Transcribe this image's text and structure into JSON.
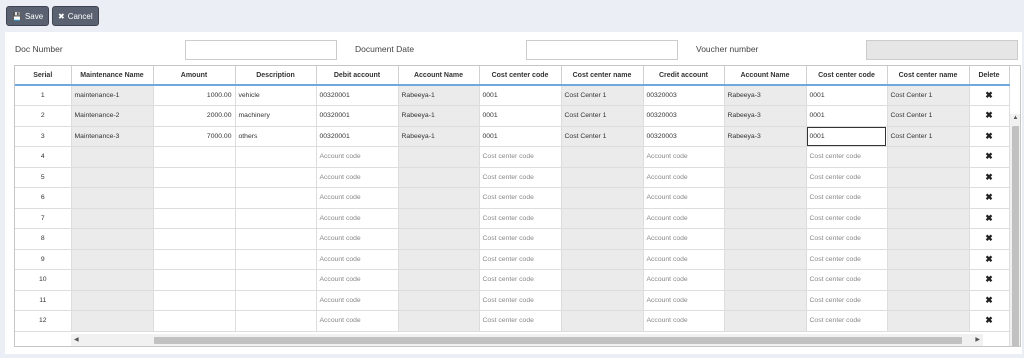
{
  "toolbar": {
    "save_label": "Save",
    "cancel_label": "Cancel",
    "save_icon": "floppy-icon",
    "cancel_icon": "close-icon"
  },
  "form": {
    "doc_number_label": "Doc Number",
    "doc_number_value": "",
    "document_date_label": "Document Date",
    "document_date_value": "",
    "voucher_number_label": "Voucher number",
    "voucher_number_value": ""
  },
  "table": {
    "columns": [
      "Serial",
      "Maintenance Name",
      "Amount",
      "Description",
      "Debit account",
      "Account Name",
      "Cost center code",
      "Cost center name",
      "Credit account",
      "Account Name",
      "Cost center code",
      "Cost center name",
      "Delete"
    ],
    "rows": [
      [
        "1",
        "maintenance-1",
        "1000.00",
        "vehicle",
        "00320001",
        "Rabeeya-1",
        "0001",
        "Cost Center 1",
        "00320003",
        "Rabeeya-3",
        "0001",
        "Cost Center 1"
      ],
      [
        "2",
        "Maintenance-2",
        "2000.00",
        "machinery",
        "00320001",
        "Rabeeya-1",
        "0001",
        "Cost Center 1",
        "00320003",
        "Rabeeya-3",
        "0001",
        "Cost Center 1"
      ],
      [
        "3",
        "Maintenance-3",
        "7000.00",
        "others",
        "00320001",
        "Rabeeya-1",
        "0001",
        "Cost Center 1",
        "00320003",
        "Rabeeya-3",
        "0001",
        "Cost Center 1"
      ],
      [
        "4",
        "",
        "",
        "",
        "",
        "",
        "",
        "",
        "",
        "",
        "",
        ""
      ],
      [
        "5",
        "",
        "",
        "",
        "",
        "",
        "",
        "",
        "",
        "",
        "",
        ""
      ],
      [
        "6",
        "",
        "",
        "",
        "",
        "",
        "",
        "",
        "",
        "",
        "",
        ""
      ],
      [
        "7",
        "",
        "",
        "",
        "",
        "",
        "",
        "",
        "",
        "",
        "",
        ""
      ],
      [
        "8",
        "",
        "",
        "",
        "",
        "",
        "",
        "",
        "",
        "",
        "",
        ""
      ],
      [
        "9",
        "",
        "",
        "",
        "",
        "",
        "",
        "",
        "",
        "",
        "",
        ""
      ],
      [
        "10",
        "",
        "",
        "",
        "",
        "",
        "",
        "",
        "",
        "",
        "",
        ""
      ],
      [
        "11",
        "",
        "",
        "",
        "",
        "",
        "",
        "",
        "",
        "",
        "",
        ""
      ],
      [
        "12",
        "",
        "",
        "",
        "",
        "",
        "",
        "",
        "",
        "",
        "",
        ""
      ]
    ],
    "placeholders": {
      "debit_account": "Account code",
      "cost_center_code": "Cost center code",
      "credit_account": "Account code",
      "cost_center_code_2": "Cost center code"
    },
    "delete_icon": "close-icon"
  },
  "colors": {
    "header_underline": "#6fa8dc",
    "readonly_cell": "#ebebeb",
    "button_bg": "#5a6170"
  }
}
